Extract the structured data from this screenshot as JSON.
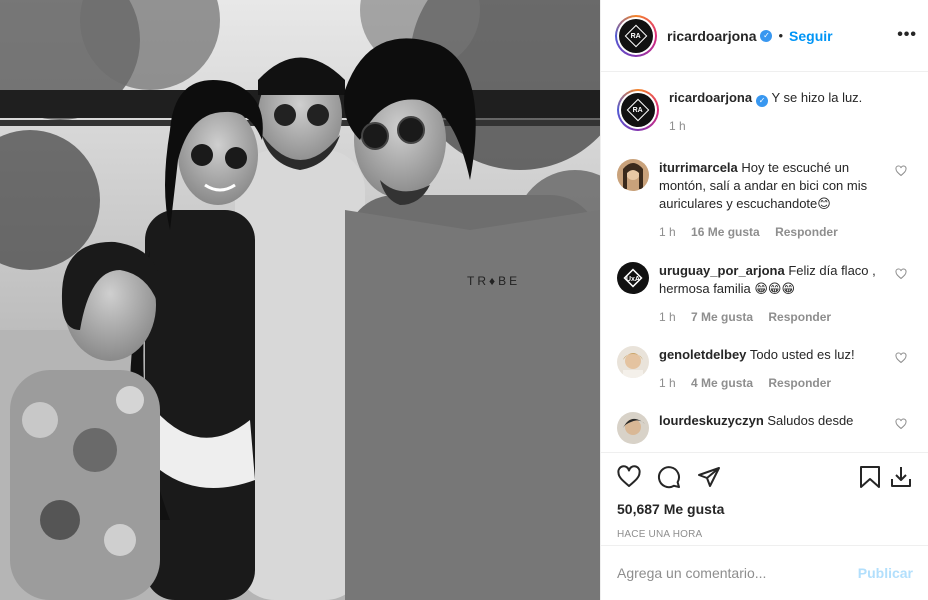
{
  "post": {
    "photo_alt": "foto",
    "username": "ricardoarjona",
    "follow_label": "Seguir",
    "more_label": "•••",
    "logo_text": "RA"
  },
  "caption": {
    "username": "ricardoarjona",
    "text": "Y se hizo la luz.",
    "time": "1 h"
  },
  "comments": [
    {
      "username": "iturrimarcela",
      "text": "Hoy te escuché un montón, salí a andar en bici con mis auriculares y escuchandote😊",
      "time": "1 h",
      "likes": "16 Me gusta",
      "reply": "Responder"
    },
    {
      "username": "uruguay_por_arjona",
      "text": "Feliz día flaco , hermosa familia 😁😁😁",
      "time": "1 h",
      "likes": "7 Me gusta",
      "reply": "Responder"
    },
    {
      "username": "genoletdelbey",
      "text": "Todo usted es luz!",
      "time": "1 h",
      "likes": "4 Me gusta",
      "reply": "Responder"
    },
    {
      "username": "lourdeskuzyczyn",
      "text": "Saludos desde",
      "time": "",
      "likes": "",
      "reply": ""
    }
  ],
  "actions": {
    "likes_count": "50,687 Me gusta",
    "time_ago": "HACE UNA HORA",
    "comment_placeholder": "Agrega un comentario...",
    "publish_label": "Publicar"
  },
  "colors": {
    "link_blue": "#0095f6",
    "verified_blue": "#3897f0",
    "publish_disabled": "#b2dffc",
    "meta_gray": "#8e8e8e",
    "text": "#262626"
  }
}
